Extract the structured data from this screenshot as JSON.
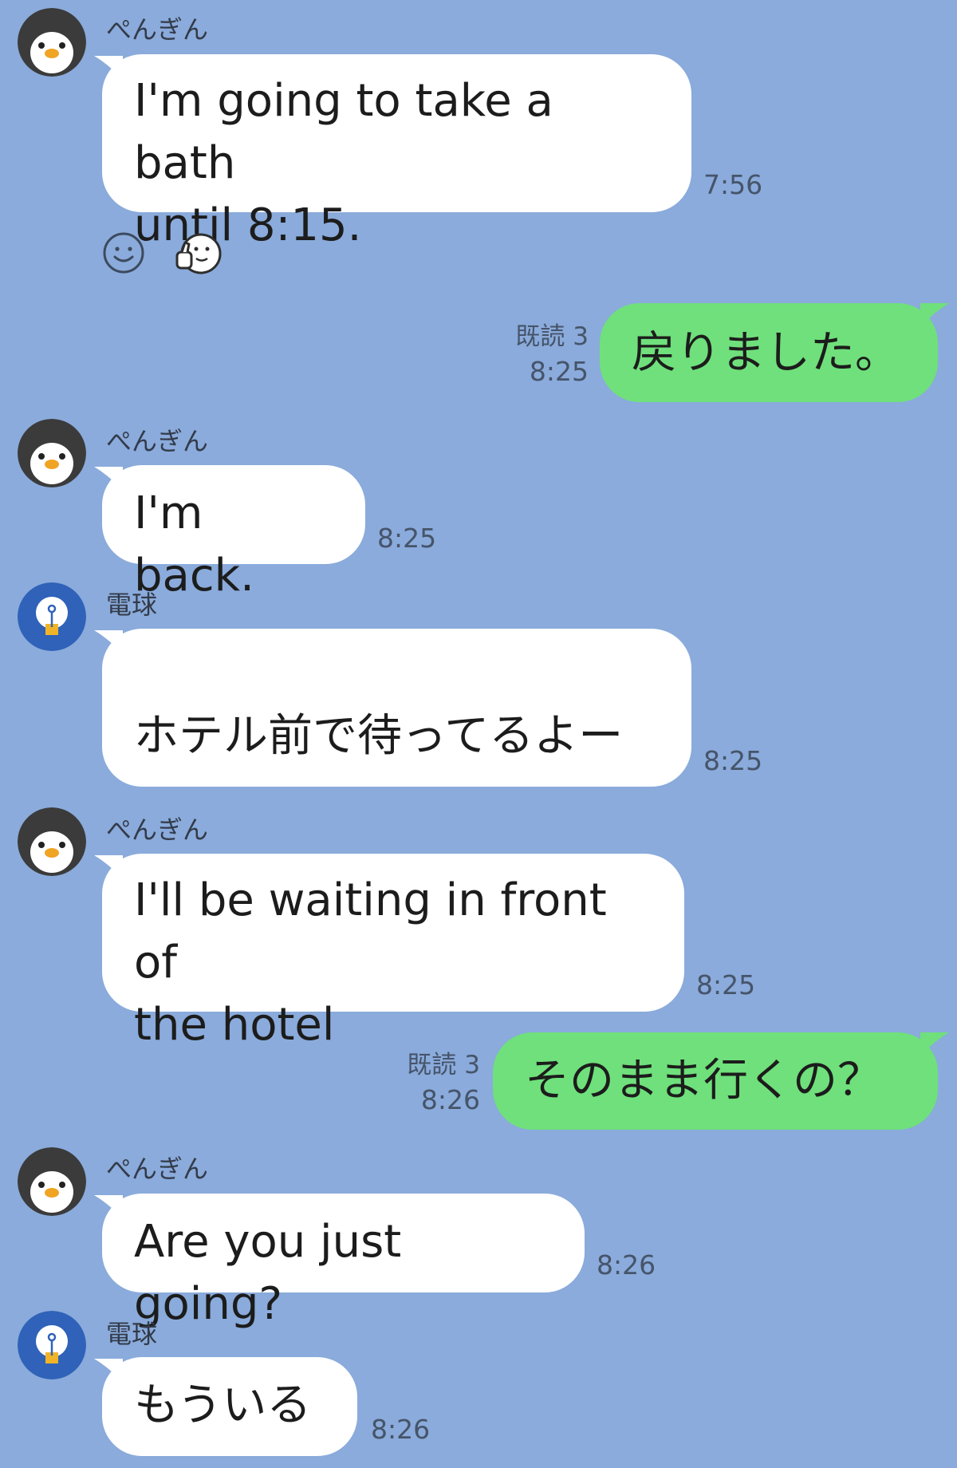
{
  "participants": {
    "penguin": {
      "name": "ぺんぎん",
      "icon": "penguin-icon",
      "color": "#3b3b3b"
    },
    "bulb": {
      "name": "電球",
      "icon": "lightbulb-icon",
      "color": "#2f62b8"
    }
  },
  "messages": [
    {
      "from": "penguin",
      "text": "I'm going to take a bath\nuntil 8:15.",
      "time": "7:56"
    },
    {
      "from": "me",
      "text": "戻りました。",
      "read": "既読 3",
      "time": "8:25"
    },
    {
      "from": "penguin",
      "text": "I'm back.",
      "time": "8:25"
    },
    {
      "from": "bulb",
      "text": "ホテル前で待ってるよー",
      "time": "8:25"
    },
    {
      "from": "penguin",
      "text": "I'll be waiting in front of\nthe hotel",
      "time": "8:25"
    },
    {
      "from": "me",
      "text": "そのまま行くの？",
      "read": "既読 3",
      "time": "8:26"
    },
    {
      "from": "penguin",
      "text": "Are you just going?",
      "time": "8:26"
    },
    {
      "from": "bulb",
      "text": "もういる",
      "time": "8:26"
    }
  ],
  "reactions": [
    "smiley-icon",
    "thumbs-up-sticker-icon"
  ],
  "colors": {
    "background": "#8aabdb",
    "incoming_bubble": "#ffffff",
    "outgoing_bubble": "#6fe07b"
  }
}
